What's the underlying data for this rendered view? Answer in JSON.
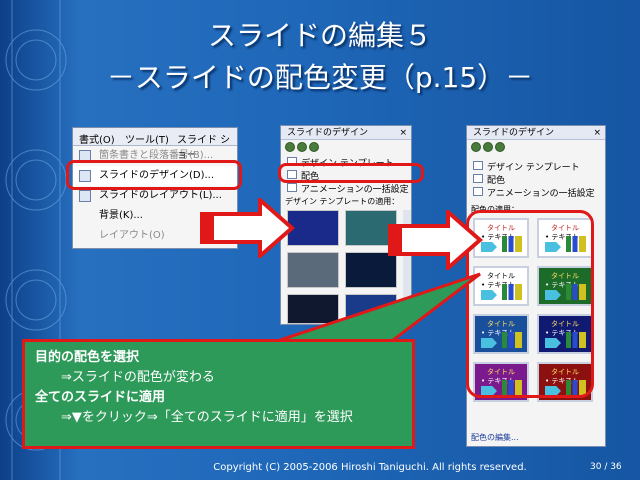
{
  "slide": {
    "title_line1": "スライドの編集５",
    "title_line2": "－スライドの配色変更（p.15）－",
    "footer": "Copyright (C) 2005-2006 Hiroshi Taniguchi. All rights reserved.",
    "page_number": "30 / 36"
  },
  "menu": {
    "bar_items": [
      "書式(O)",
      "ツール(T)",
      "スライド ショー"
    ],
    "items": [
      {
        "label": "箇条書きと段落番号(B)..."
      },
      {
        "label": "スライドのデザイン(D)..."
      },
      {
        "label": "スライドのレイアウト(L)..."
      },
      {
        "label": "背景(K)..."
      },
      {
        "label": "レイアウト(O)"
      }
    ]
  },
  "pane1": {
    "title": "スライドのデザイン",
    "close": "×",
    "links": [
      "デザイン テンプレート",
      "配色",
      "アニメーションの一括設定"
    ],
    "section": "デザイン テンプレートの適用："
  },
  "pane2": {
    "title": "スライドのデザイン",
    "close": "×",
    "links": [
      "デザイン テンプレート",
      "配色",
      "アニメーションの一括設定"
    ],
    "section": "配色の適用：",
    "thumb_title": "タイトル",
    "thumb_bullet": "• テキスト",
    "edit_link": "配色の編集...",
    "schemes": [
      {
        "bg": "#ffffff",
        "title": "#c02020",
        "text": "#000000"
      },
      {
        "bg": "#ffffff",
        "title": "#c02020",
        "text": "#000000"
      },
      {
        "bg": "#ffffff",
        "title": "#000000",
        "text": "#000000"
      },
      {
        "bg": "#1c6b28",
        "title": "#ffe060",
        "text": "#ffffff"
      },
      {
        "bg": "#1a4f9c",
        "title": "#ffe060",
        "text": "#ffffff"
      },
      {
        "bg": "#101a70",
        "title": "#ffe060",
        "text": "#ffffff"
      },
      {
        "bg": "#7a1a8c",
        "title": "#ffe060",
        "text": "#ffffff"
      },
      {
        "bg": "#8c1010",
        "title": "#ffe060",
        "text": "#ffffff"
      }
    ]
  },
  "callout": {
    "line1": "目的の配色を選択",
    "line2": "⇒スライドの配色が変わる",
    "line3": "全てのスライドに適用",
    "line4": "⇒▼をクリック⇒「全てのスライドに適用」を選択"
  },
  "colors": {
    "accent_red": "#e01818",
    "callout_green": "#2e9a5a",
    "slide_blue": "#1b5ea6"
  }
}
